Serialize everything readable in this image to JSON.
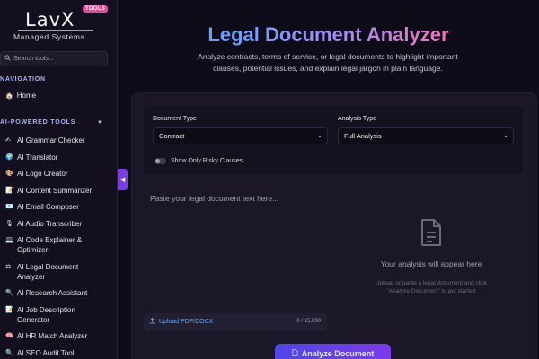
{
  "brand": {
    "logo": "LavX",
    "badge": "TOOLS",
    "subtitle": "Managed Systems"
  },
  "sidebar": {
    "search_placeholder": "Search tools...",
    "nav_title": "NAVIGATION",
    "home_label": "Home",
    "tools_title": "AI-POWERED TOOLS",
    "tools": [
      {
        "icon": "pen-icon",
        "glyph": "✍",
        "label": "AI Grammar Checker"
      },
      {
        "icon": "globe-icon",
        "glyph": "🌍",
        "label": "AI Translator"
      },
      {
        "icon": "palette-icon",
        "glyph": "🎨",
        "label": "AI Logo Creator"
      },
      {
        "icon": "memo-icon",
        "glyph": "📝",
        "label": "AI Content Summarizer"
      },
      {
        "icon": "email-icon",
        "glyph": "📧",
        "label": "AI Email Composer"
      },
      {
        "icon": "microphone-icon",
        "glyph": "🎙",
        "label": "AI Audio Transcriber"
      },
      {
        "icon": "laptop-icon",
        "glyph": "💻",
        "label": "AI Code Explainer & Optimizer"
      },
      {
        "icon": "scales-icon",
        "glyph": "⚖",
        "label": "AI Legal Document Analyzer"
      },
      {
        "icon": "magnifier-icon",
        "glyph": "🔍",
        "label": "AI Research Assistant"
      },
      {
        "icon": "memo-icon",
        "glyph": "📝",
        "label": "AI Job Description Generator"
      },
      {
        "icon": "brain-icon",
        "glyph": "🧠",
        "label": "AI HR Match Analyzer"
      },
      {
        "icon": "magnifier-icon",
        "glyph": "🔍",
        "label": "AI SEO Audit Tool"
      }
    ]
  },
  "main": {
    "title": "Legal Document Analyzer",
    "subtitle": "Analyze contracts, terms of service, or legal documents to highlight important clauses, potential issues, and explain legal jargon in plain language.",
    "document_type_label": "Document Type",
    "document_type_value": "Contract",
    "analysis_type_label": "Analysis Type",
    "analysis_type_value": "Full Analysis",
    "toggle_label": "Show Only Risky Clauses",
    "textarea_placeholder": "Paste your legal document text here...",
    "upload_label": "Upload PDF/DOCX",
    "char_count": "0 / 15,000",
    "result_title": "Your analysis will appear here",
    "result_hint": "Upload or paste a legal document and click \"Analyze Document\" to get started",
    "analyze_label": "Analyze Document"
  },
  "colors": {
    "accent": "#7c3aed",
    "link": "#60a5fa",
    "badge": "#ec4899",
    "background": "#0f0c1a"
  }
}
